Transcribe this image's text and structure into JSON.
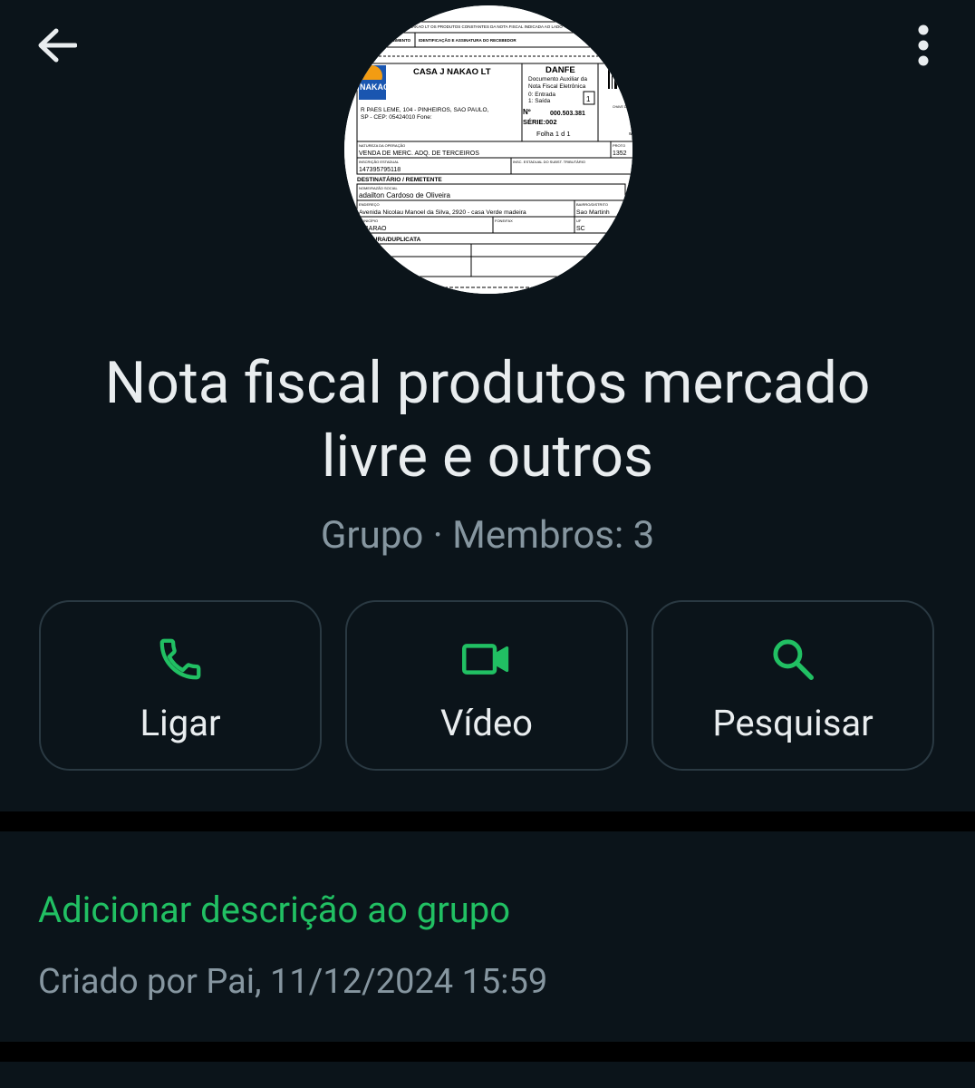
{
  "header": {
    "back_icon": "arrow-left-icon",
    "more_icon": "more-vertical-icon"
  },
  "avatar": {
    "doc_type": "DANFE",
    "doc_subtitle_1": "Documento Auxiliar da",
    "doc_subtitle_2": "Nota Fiscal Eletrônica",
    "entry_exit_1": "0: Entrada",
    "entry_exit_2": "1: Saída",
    "entry_exit_value": "1",
    "company": "CASA J NAKAO LT",
    "logo_text": "NAKAO",
    "address_1": "R PAES LEME, 104 - PINHEIROS, SAO PAULO,",
    "address_2": "SP - CEP: 05424010 Fone:",
    "number_label": "Nº",
    "number": "000.503.381",
    "serie": "SÉRIE:002",
    "folha": "Folha   1  d  1",
    "receipt_label": "IDENTIFICAÇÃO E ASSINATURA DO RECEBEDOR",
    "receipt_label_left": "RECEBIMENTO",
    "top_strip": "NAKAO LT OS PRODUTOS CONSTANTES DA NOTA FISCAL INDICADA AO LADO",
    "nature_label": "NATUREZA DA OPERAÇÃO",
    "nature": "VENDA DE MERC. ADQ. DE TERCEIROS",
    "protocol_label": "PROTO",
    "protocol": "1352",
    "state_reg_label": "INSCRIÇÃO ESTADUAL",
    "state_reg": "147395795118",
    "sub_reg_label": "INSC. ESTADUAL DO SUBST. TRIBUTÁRIO",
    "dest_header": "DESTINATÁRIO / REMETENTE",
    "name_label": "NOME/RAZÃO SOCIAL",
    "name": "adailton Cardoso de Oliveira",
    "endereco_label": "ENDEREÇO",
    "endereco": "Avenida Nicolau Manoel da Silva, 2920 - casa Verde madeira",
    "bairro_label": "BAIRRO/DISTRITO",
    "bairro": "Sao Martinh",
    "municipio_label": "MUNICÍPIO",
    "municipio": "BARAO",
    "fone_label": "FONE/FAX",
    "uf_label": "UF",
    "uf": "SC",
    "fatura_header": "FATURA/DUPLICATA",
    "chave_label": "CHAVE DE",
    "www": "www"
  },
  "group": {
    "title_line1": "Nota fiscal produtos mercado",
    "title_line2": "livre e outros",
    "subtitle": "Grupo · Membros: 3"
  },
  "actions": [
    {
      "label": "Ligar",
      "icon": "phone-icon"
    },
    {
      "label": "Vídeo",
      "icon": "video-camera-icon"
    },
    {
      "label": "Pesquisar",
      "icon": "search-icon"
    }
  ],
  "description": {
    "add_label": "Adicionar descrição ao grupo",
    "created_by": "Criado por Pai, 11/12/2024 15:59"
  },
  "colors": {
    "background": "#0b141a",
    "accent": "#21c063",
    "primary_text": "#e9edef",
    "secondary_text": "#8696a0",
    "divider": "#000000"
  }
}
